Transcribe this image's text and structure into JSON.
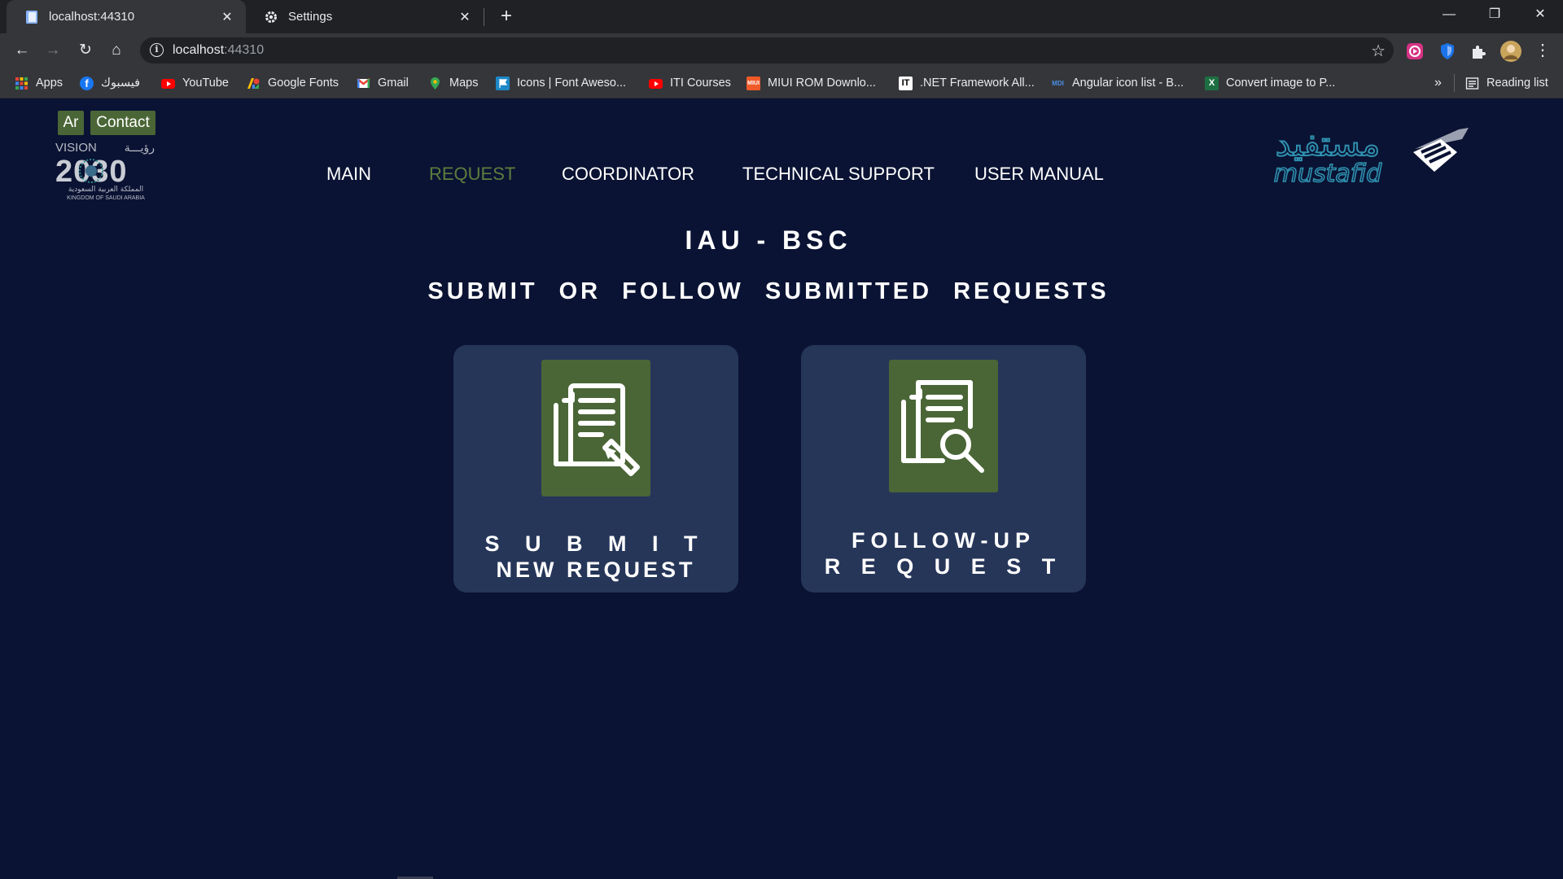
{
  "browser": {
    "tabs": [
      {
        "title": "localhost:44310",
        "icon": "page-icon",
        "active": true
      },
      {
        "title": "Settings",
        "icon": "gear-icon",
        "active": false
      }
    ],
    "address": {
      "host": "localhost",
      "port": ":44310"
    },
    "bookmarks": [
      {
        "label": "Apps",
        "icon": "apps-grid-icon"
      },
      {
        "label": "فيسبوك",
        "icon": "facebook-icon"
      },
      {
        "label": "YouTube",
        "icon": "youtube-icon"
      },
      {
        "label": "Google Fonts",
        "icon": "google-fonts-icon"
      },
      {
        "label": "Gmail",
        "icon": "gmail-icon"
      },
      {
        "label": "Maps",
        "icon": "maps-icon"
      },
      {
        "label": "Icons | Font Aweso...",
        "icon": "font-awesome-icon"
      },
      {
        "label": "ITI Courses",
        "icon": "youtube-icon"
      },
      {
        "label": "MIUI ROM Downlo...",
        "icon": "miui-icon"
      },
      {
        "label": ".NET Framework All...",
        "icon": "it-icon"
      },
      {
        "label": "Angular icon list - B...",
        "icon": "mdi-icon"
      },
      {
        "label": "Convert image to P...",
        "icon": "excel-icon"
      }
    ],
    "overflow": "»",
    "reading_list": "Reading list"
  },
  "header": {
    "lang_button": "Ar",
    "contact_button": "Contact",
    "logo_left": {
      "word": "VISION",
      "arabic_word": "رؤيـــة",
      "number": "2030",
      "arabic_country": "المملكة العربية السعودية",
      "country": "KINGDOM OF SAUDI ARABIA"
    },
    "logo_right": {
      "arabic": "مستفيد",
      "latin": "mustafid"
    }
  },
  "nav": {
    "items": [
      {
        "label": "MAIN",
        "active": false
      },
      {
        "label": "REQUEST",
        "active": true
      },
      {
        "label": "COORDINATOR",
        "active": false
      },
      {
        "label": "TECHNICAL SUPPORT",
        "active": false
      },
      {
        "label": "USER MANUAL",
        "active": false
      }
    ]
  },
  "main": {
    "title": "IAU - BSC",
    "subtitle": "SUBMIT OR FOLLOW SUBMITTED REQUESTS",
    "cards": [
      {
        "line1": "S U B M I T",
        "line2": "NEW REQUEST",
        "icon": "document-edit-icon"
      },
      {
        "line1": "FOLLOW-UP",
        "line2": "R E Q U E S T",
        "icon": "document-search-icon"
      }
    ]
  },
  "colors": {
    "page_bg": "#0a1333",
    "card_bg": "#263659",
    "accent_green": "#4a6636",
    "nav_active": "#5e7d3d",
    "logo_teal": "#2f8fae"
  }
}
